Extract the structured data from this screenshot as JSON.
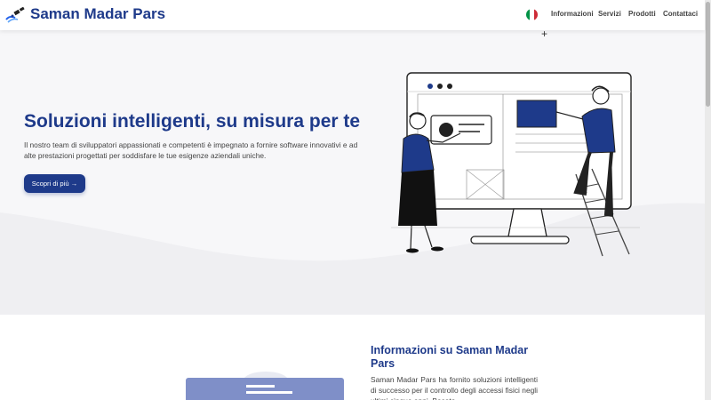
{
  "header": {
    "brand": "Saman Madar Pars",
    "logo_icon": "satellite-logo-icon",
    "language_icon": "italy-flag-icon",
    "flag_colors": [
      "#009246",
      "#ffffff",
      "#ce2b37"
    ],
    "nav": [
      "Informazioni",
      "Servizi",
      "Prodotti",
      "Contattaci"
    ]
  },
  "hero": {
    "title": "Soluzioni intelligenti, su misura per te",
    "subtitle": "Il nostro team di sviluppatori appassionati e competenti è impegnato a fornire software innovativi e ad alte prestazioni progettati per soddisfare le tue esigenze aziendali uniche.",
    "cta_label": "Scopri di più →",
    "illustration": "people-building-website-illustration"
  },
  "about": {
    "title": "Informazioni su Saman Madar Pars",
    "text": "Saman Madar Pars ha fornito soluzioni intelligenti di successo per il controllo degli accessi fisici negli ultimi cinque anni. Basato"
  },
  "colors": {
    "primary": "#1e3a8a",
    "hero_bg": "#f7f7f9",
    "text": "#444444"
  }
}
